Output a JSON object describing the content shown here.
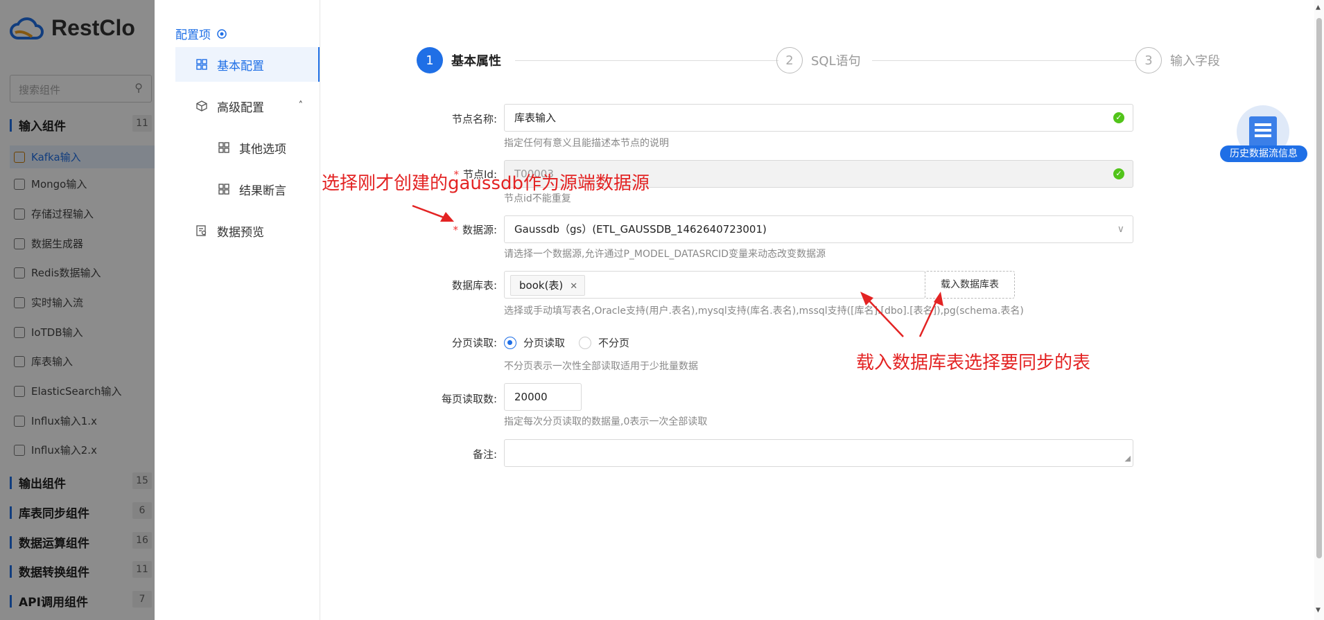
{
  "background_app": {
    "logo_text": "RestClo",
    "search_placeholder": "搜索组件",
    "groups": [
      {
        "label": "输入组件",
        "count": "11"
      },
      {
        "label": "输出组件",
        "count": "15"
      },
      {
        "label": "库表同步组件",
        "count": "6"
      },
      {
        "label": "数据运算组件",
        "count": "16"
      },
      {
        "label": "数据转换组件",
        "count": "11"
      },
      {
        "label": "API调用组件",
        "count": "7"
      }
    ],
    "input_items": [
      "Kafka输入",
      "Mongo输入",
      "存储过程输入",
      "数据生成器",
      "Redis数据输入",
      "实时输入流",
      "IoTDB输入",
      "库表输入",
      "ElasticSearch输入",
      "Influx输入1.x",
      "Influx输入2.x"
    ]
  },
  "left_menu": {
    "title": "配置项",
    "items": [
      {
        "label": "基本配置"
      },
      {
        "label": "高级配置"
      },
      {
        "label": "其他选项"
      },
      {
        "label": "结果断言"
      },
      {
        "label": "数据预览"
      }
    ]
  },
  "steps": [
    {
      "number": "1",
      "label": "基本属性"
    },
    {
      "number": "2",
      "label": "SQL语句"
    },
    {
      "number": "3",
      "label": "输入字段"
    }
  ],
  "form": {
    "node_name": {
      "label": "节点名称:",
      "value": "库表输入",
      "hint": "指定任何有意义且能描述本节点的说明"
    },
    "node_id": {
      "label": "节点Id:",
      "value": "T00003",
      "hint": "节点id不能重复"
    },
    "datasource": {
      "label": "数据源:",
      "value": "Gaussdb（gs）(ETL_GAUSSDB_1462640723001)",
      "hint": "请选择一个数据源,允许通过P_MODEL_DATASRCID变量来动态改变数据源"
    },
    "table": {
      "label": "数据库表:",
      "tag": "book(表)",
      "load_button": "载入数据库表",
      "hint": "选择或手动填写表名,Oracle支持(用户.表名),mysql支持(库名.表名),mssql支持([库名].[dbo].[表名]),pg(schema.表名)"
    },
    "paging": {
      "label": "分页读取:",
      "option_on": "分页读取",
      "option_off": "不分页",
      "hint": "不分页表示一次性全部读取适用于少批量数据"
    },
    "page_size": {
      "label": "每页读取数:",
      "value": "20000",
      "hint": "指定每次分页读取的数据量,0表示一次全部读取"
    },
    "remark": {
      "label": "备注:",
      "value": ""
    }
  },
  "annotations": {
    "datasource_note": "选择刚才创建的gaussdb作为源端数据源",
    "table_note": "载入数据库表选择要同步的表"
  },
  "history_button": {
    "label": "历史数据流信息"
  },
  "colors": {
    "primary": "#1f6fe6",
    "annotation": "#e32323",
    "success": "#52c41a"
  }
}
